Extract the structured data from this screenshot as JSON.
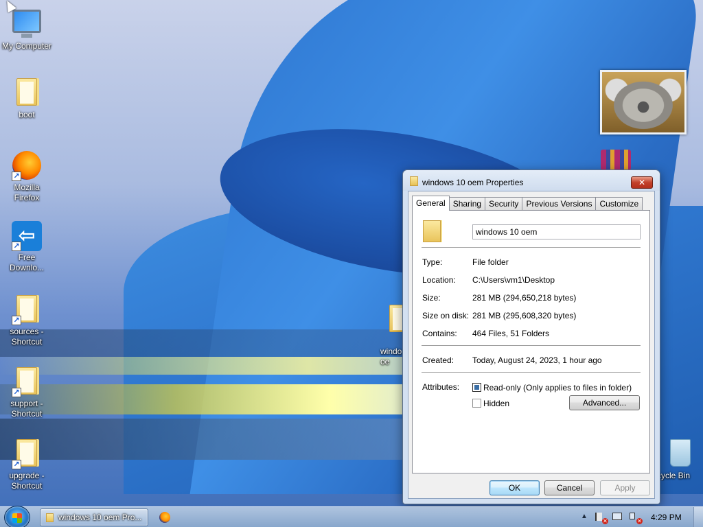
{
  "desktop": {
    "icons": [
      {
        "label": "My Computer"
      },
      {
        "label": "boot"
      },
      {
        "label": "Mozilla Firefox"
      },
      {
        "label": "Free Downlo..."
      },
      {
        "label": "sources - Shortcut"
      },
      {
        "label": "support - Shortcut"
      },
      {
        "label": "upgrade - Shortcut"
      },
      {
        "label": "windo\noe"
      },
      {
        "label": "cycle Bin"
      }
    ]
  },
  "dialog": {
    "title": "windows 10 oem Properties",
    "close_label": "✕",
    "tabs": [
      {
        "label": "General"
      },
      {
        "label": "Sharing"
      },
      {
        "label": "Security"
      },
      {
        "label": "Previous Versions"
      },
      {
        "label": "Customize"
      }
    ],
    "folder_name": "windows 10 oem",
    "type_label": "Type:",
    "type_value": "File folder",
    "location_label": "Location:",
    "location_value": "C:\\Users\\vm1\\Desktop",
    "size_label": "Size:",
    "size_value": "281 MB (294,650,218 bytes)",
    "size_on_disk_label": "Size on disk:",
    "size_on_disk_value": "281 MB (295,608,320 bytes)",
    "contains_label": "Contains:",
    "contains_value": "464 Files, 51 Folders",
    "created_label": "Created:",
    "created_value": "Today, August 24, 2023, 1 hour ago",
    "attributes_label": "Attributes:",
    "readonly_label": "Read-only (Only applies to files in folder)",
    "hidden_label": "Hidden",
    "advanced_label": "Advanced...",
    "ok_label": "OK",
    "cancel_label": "Cancel",
    "apply_label": "Apply"
  },
  "taskbar": {
    "window_button_label": "windows 10 oem Pro...",
    "clock": "4:29 PM",
    "tray_arrow": "▲"
  }
}
